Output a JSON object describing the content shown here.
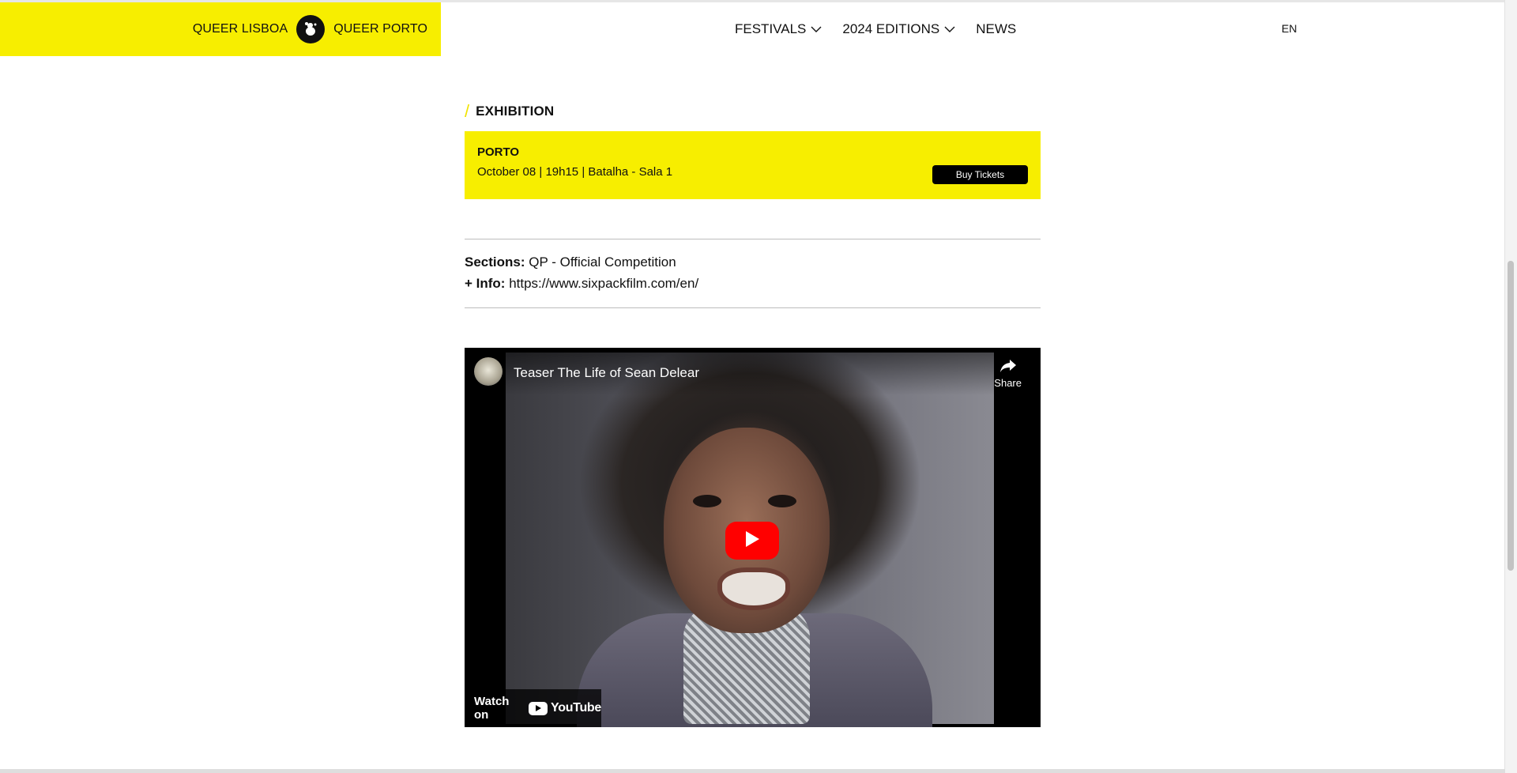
{
  "header": {
    "brand_left": "QUEER LISBOA",
    "brand_right": "QUEER PORTO",
    "nav": [
      {
        "label": "FESTIVALS",
        "has_dropdown": true
      },
      {
        "label": "2024 EDITIONS",
        "has_dropdown": true
      },
      {
        "label": "NEWS",
        "has_dropdown": false
      }
    ],
    "language": "EN"
  },
  "exhibition": {
    "heading": "EXHIBITION",
    "city": "PORTO",
    "details": "October 08 | 19h15 | Batalha - Sala 1",
    "buy_label": "Buy Tickets"
  },
  "meta": {
    "sections_label": "Sections:",
    "sections_value": "QP - Official Competition",
    "info_label": "+ Info:",
    "info_value": "https://www.sixpackfilm.com/en/"
  },
  "video": {
    "title": "Teaser The Life of Sean Delear",
    "share_label": "Share",
    "watch_on": "Watch on",
    "platform": "YouTube"
  },
  "colors": {
    "accent_yellow": "#f7ee00",
    "text": "#111111",
    "play_red": "#ff0000"
  },
  "icons": [
    "queer-logo-icon",
    "chevron-down-icon",
    "share-icon",
    "play-icon",
    "youtube-icon"
  ]
}
